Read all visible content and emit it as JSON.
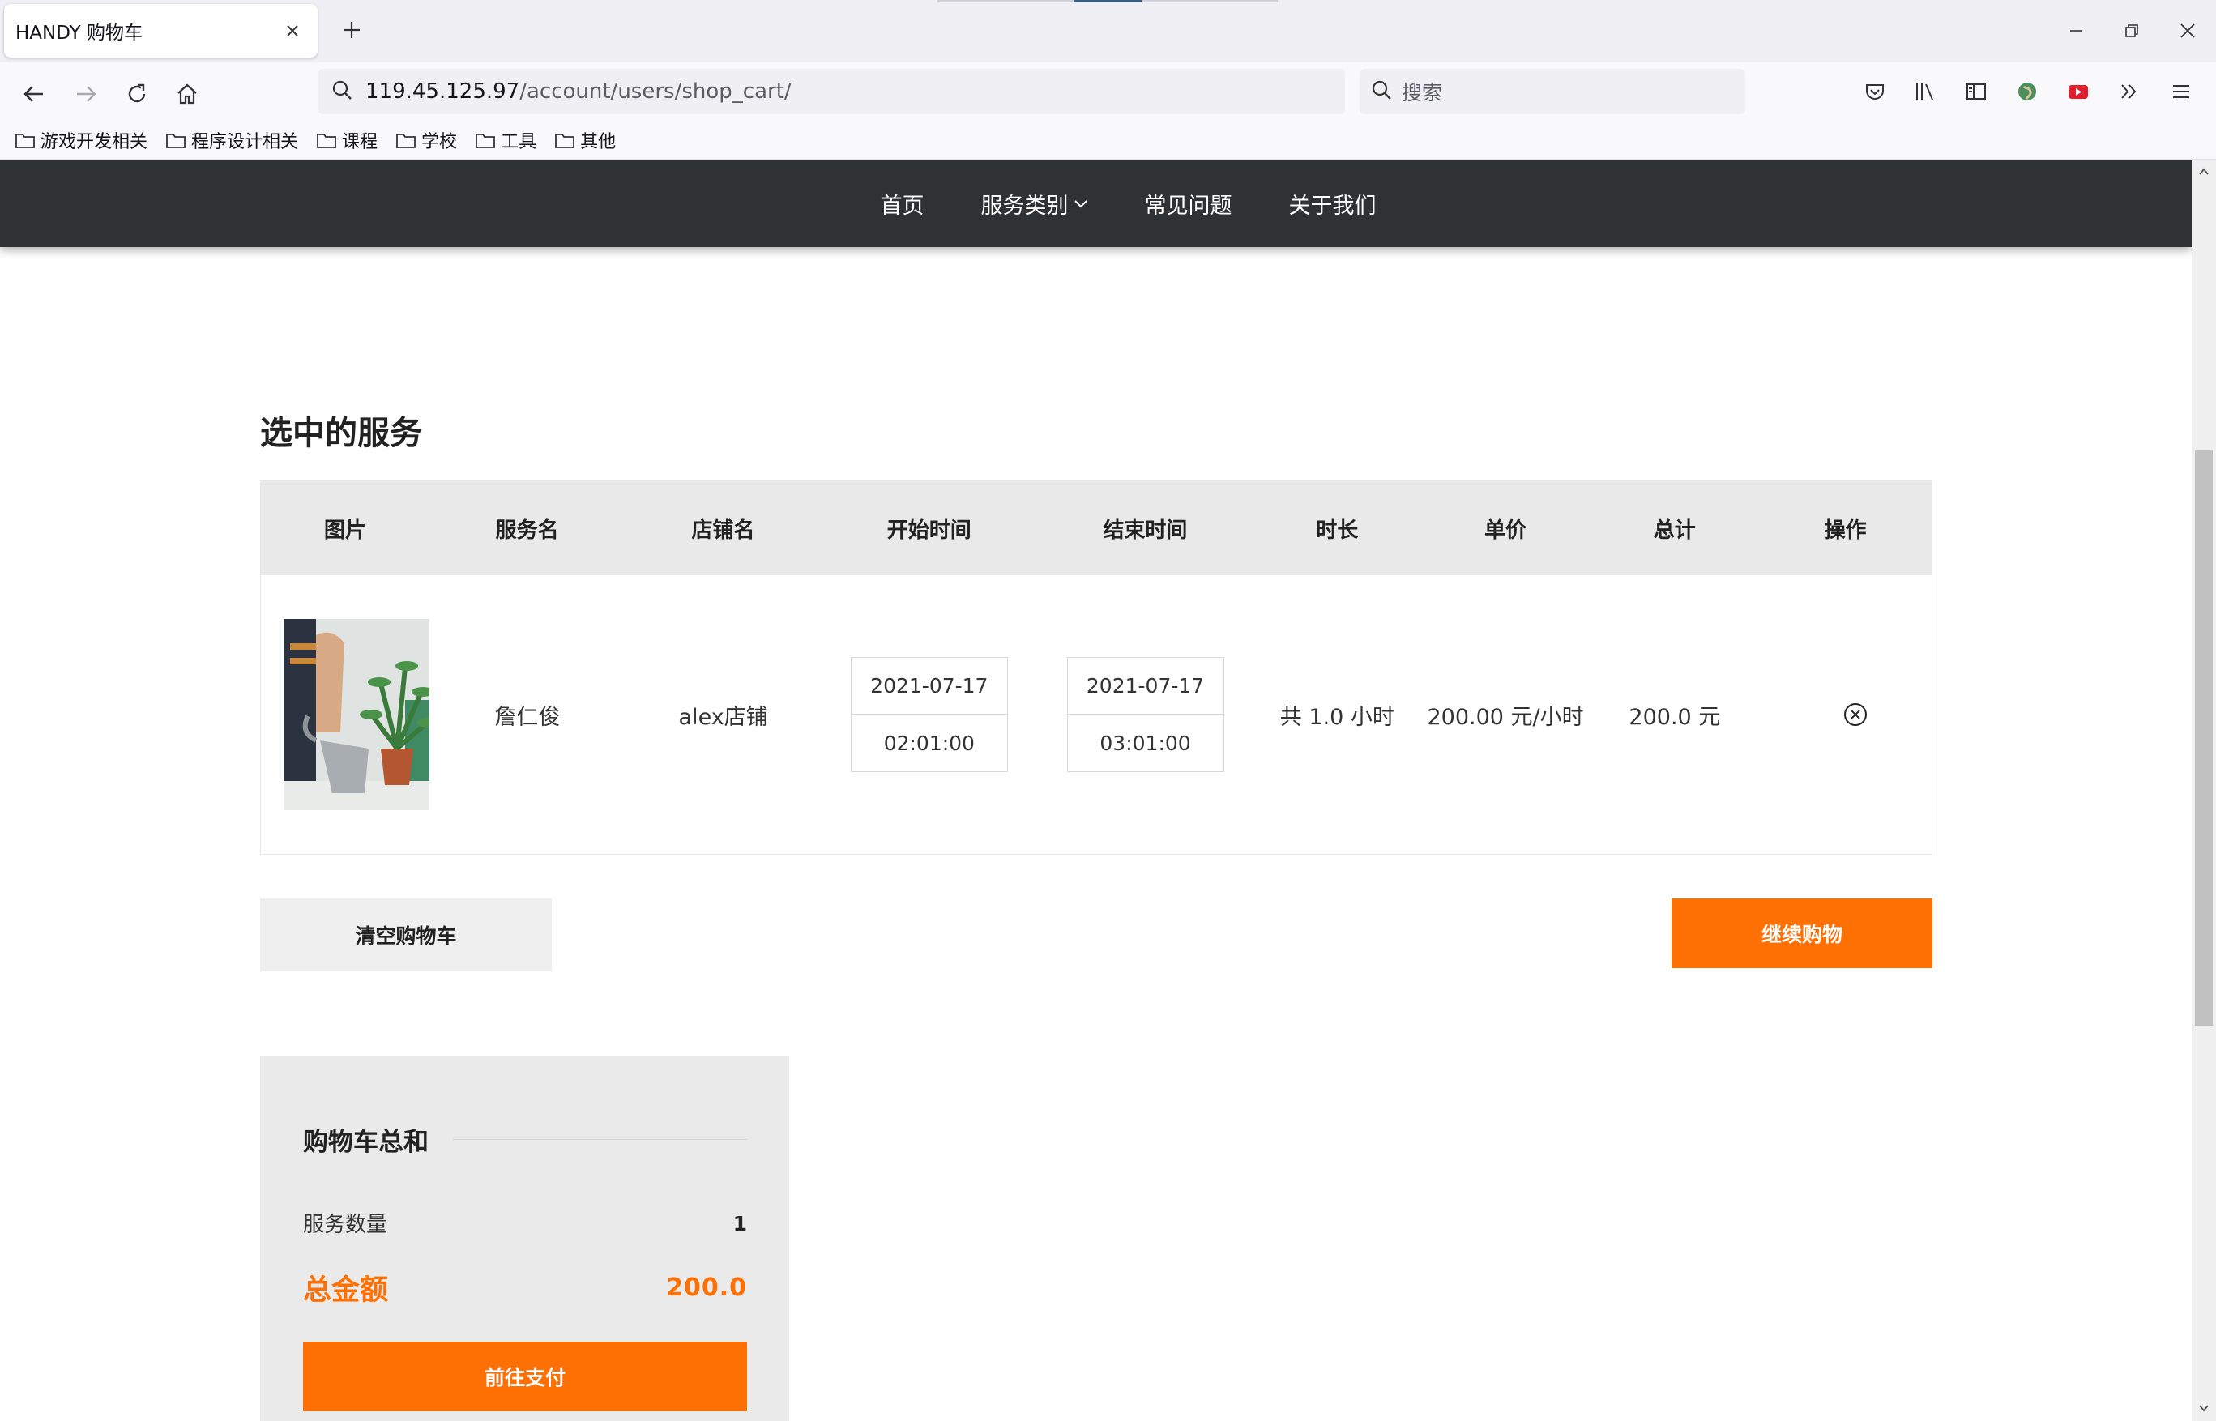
{
  "browser": {
    "tab_title": "HANDY 购物车",
    "url_host": "119.45.125.97",
    "url_path": "/account/users/shop_cart/",
    "search_placeholder": "搜索",
    "bookmarks": [
      "游戏开发相关",
      "程序设计相关",
      "课程",
      "学校",
      "工具",
      "其他"
    ]
  },
  "site_nav": {
    "items": [
      "首页",
      "服务类别",
      "常见问题",
      "关于我们"
    ]
  },
  "cart": {
    "section_title": "选中的服务",
    "columns": [
      "图片",
      "服务名",
      "店铺名",
      "开始时间",
      "结束时间",
      "时长",
      "单价",
      "总计",
      "操作"
    ],
    "rows": [
      {
        "service_name": "詹仁俊",
        "shop_name": "alex店铺",
        "start_date": "2021-07-17",
        "start_time": "02:01:00",
        "end_date": "2021-07-17",
        "end_time": "03:01:00",
        "duration": "共 1.0 小时",
        "unit_price": "200.00 元/小时",
        "total": "200.0 元"
      }
    ],
    "clear_button": "清空购物车",
    "continue_button": "继续购物"
  },
  "summary": {
    "title": "购物车总和",
    "count_label": "服务数量",
    "count_value": "1",
    "total_label": "总金额",
    "total_value": "200.0",
    "pay_button": "前往支付"
  },
  "colors": {
    "accent": "#ff7004",
    "header_bg": "#2f3234",
    "table_head_bg": "#e9e9e9",
    "summary_bg": "#eaeaea"
  }
}
